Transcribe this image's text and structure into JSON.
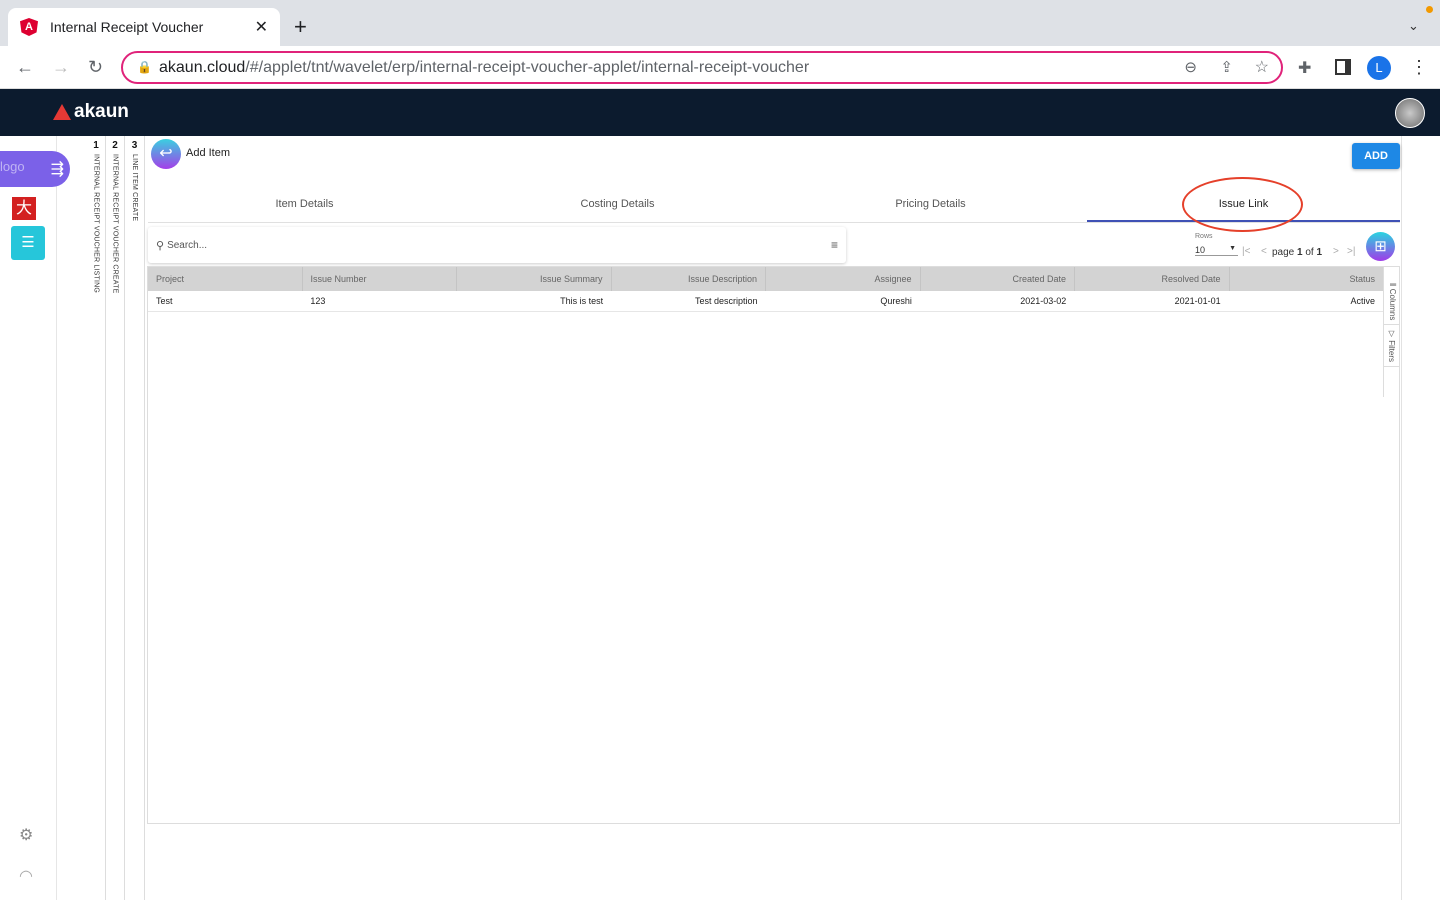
{
  "browser": {
    "tab_title": "Internal Receipt Voucher",
    "url_host": "akaun.cloud",
    "url_path": "/#/applet/tnt/wavelet/erp/internal-receipt-voucher-applet/internal-receipt-voucher",
    "profile_initial": "L"
  },
  "app": {
    "brand": "akaun",
    "logo_alt": "logo"
  },
  "vertical_tabs": [
    {
      "num": "1",
      "label": "INTERNAL RECEIPT VOUCHER LISTING"
    },
    {
      "num": "2",
      "label": "INTERNAL RECEIPT VOUCHER CREATE"
    },
    {
      "num": "3",
      "label": "LINE ITEM CREATE"
    }
  ],
  "page": {
    "title": "Add Item",
    "add_label": "ADD"
  },
  "tabs": [
    "Item Details",
    "Costing Details",
    "Pricing Details",
    "Issue Link"
  ],
  "search": {
    "placeholder": "Search..."
  },
  "pagination": {
    "rows_label": "Rows",
    "rows_value": "10",
    "page_word": "page",
    "page": "1",
    "of_word": "of",
    "total": "1"
  },
  "table": {
    "headers": [
      "Project",
      "Issue Number",
      "Issue Summary",
      "Issue Description",
      "Assignee",
      "Created Date",
      "Resolved Date",
      "Status"
    ],
    "rows": [
      [
        "Test",
        "123",
        "This is test",
        "Test description",
        "Qureshi",
        "2021-03-02",
        "2021-01-01",
        "Active"
      ]
    ]
  },
  "side_panel": {
    "columns": "Columns",
    "filters": "Filters"
  }
}
